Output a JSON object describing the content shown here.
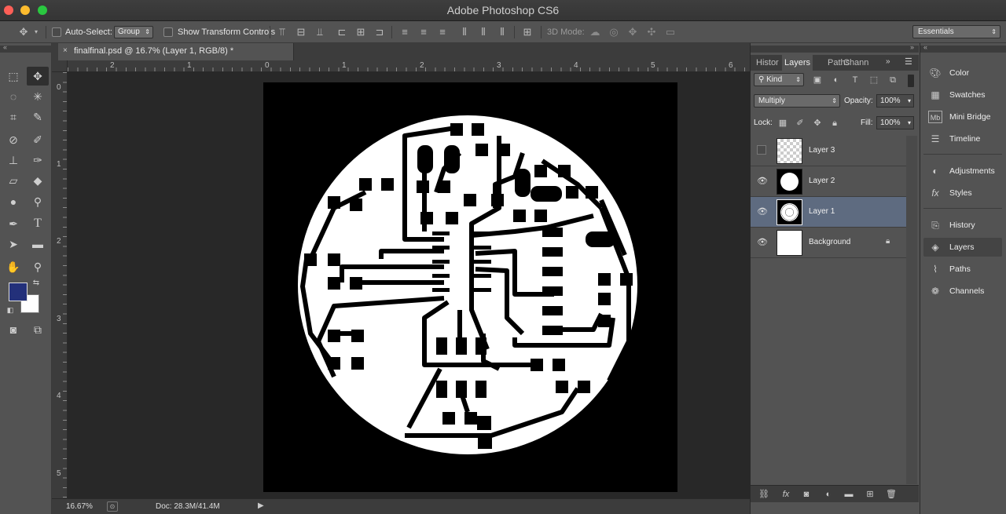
{
  "app_title": "Adobe Photoshop CS6",
  "options_bar": {
    "auto_select_label": "Auto-Select:",
    "auto_select_value": "Group",
    "transform_label": "Show Transform Controls",
    "mode_3d_label": "3D Mode:",
    "workspace": "Essentials"
  },
  "document": {
    "tab_title": "finalfinal.psd @ 16.7% (Layer 1, RGB/8) *",
    "close": "×"
  },
  "rulers": {
    "horizontal": [
      "2",
      "1",
      "0",
      "1",
      "2",
      "3",
      "4",
      "5",
      "6"
    ],
    "vertical": [
      "0",
      "1",
      "2",
      "3",
      "4",
      "5"
    ]
  },
  "status": {
    "zoom": "16.67%",
    "doc_size": "Doc: 28.3M/41.4M"
  },
  "layers_panel": {
    "tabs": [
      "Histor",
      "Layers",
      "Paths",
      "Chann"
    ],
    "active_tab": "Layers",
    "kind": "Kind",
    "blend_mode": "Multiply",
    "opacity_label": "Opacity:",
    "opacity": "100%",
    "lock_label": "Lock:",
    "fill_label": "Fill:",
    "fill": "100%",
    "layers": [
      {
        "name": "Layer 3",
        "visible": false
      },
      {
        "name": "Layer 2",
        "visible": true
      },
      {
        "name": "Layer 1",
        "visible": true,
        "selected": true
      },
      {
        "name": "Background",
        "visible": true,
        "locked": true
      }
    ]
  },
  "dock": {
    "items": [
      "Color",
      "Swatches",
      "Mini Bridge",
      "Timeline",
      "Adjustments",
      "Styles",
      "History",
      "Layers",
      "Paths",
      "Channels"
    ],
    "active": "Layers"
  },
  "colors": {
    "foreground": "#23307a",
    "background": "#ffffff",
    "selection": "#5e6b80"
  }
}
